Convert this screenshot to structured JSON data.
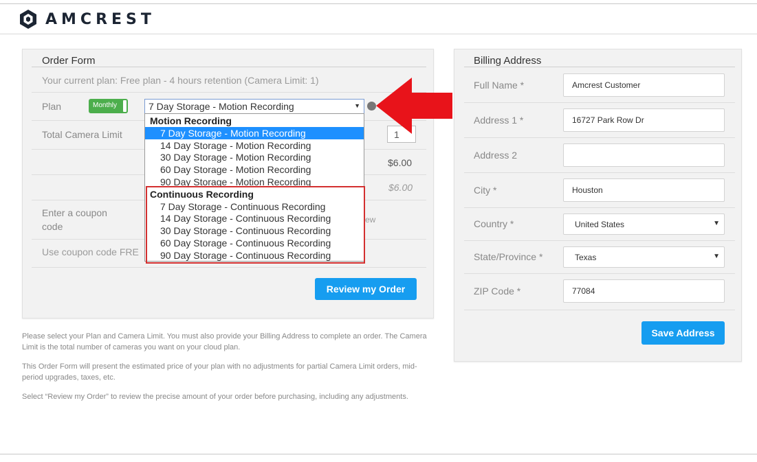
{
  "brand": {
    "name": "AMCREST"
  },
  "order_form": {
    "title": "Order Form",
    "current_plan": "Your current plan: Free plan - 4 hours retention (Camera Limit: 1)",
    "plan_label": "Plan",
    "billing_toggle": "Monthly",
    "plan_selected": "7 Day Storage - Motion Recording",
    "plan_options": {
      "motion_group": "Motion Recording",
      "motion": [
        "7 Day Storage - Motion Recording",
        "14 Day Storage - Motion Recording",
        "30 Day Storage - Motion Recording",
        "60 Day Storage - Motion Recording",
        "90 Day Storage - Motion Recording"
      ],
      "continuous_group": "Continuous Recording",
      "continuous": [
        "7 Day Storage - Continuous Recording",
        "14 Day Storage - Continuous Recording",
        "30 Day Storage - Continuous Recording",
        "60 Day Storage - Continuous Recording",
        "90 Day Storage - Continuous Recording"
      ]
    },
    "camera_limit_label": "Total Camera Limit",
    "camera_limit_value": "1",
    "price": "$6.00",
    "total": "$6.00",
    "coupon_label_1": "Enter a coupon",
    "coupon_label_2": "code",
    "coupon_hint_partial": "ew",
    "coupon_note_partial": "Use coupon code FRE",
    "review_button": "Review my Order"
  },
  "help_text": [
    "Please select your Plan and Camera Limit. You must also provide your Billing Address to complete an order. The Camera Limit is the total number of cameras you want on your cloud plan.",
    "This Order Form will present the estimated price of your plan with no adjustments for partial Camera Limit orders, mid-period upgrades, taxes, etc.",
    "Select “Review my Order” to review the precise amount of your order before purchasing, including any adjustments."
  ],
  "billing": {
    "title": "Billing Address",
    "full_name": {
      "label": "Full Name *",
      "value": "Amcrest Customer"
    },
    "address1": {
      "label": "Address 1 *",
      "value": "16727 Park Row Dr"
    },
    "address2": {
      "label": "Address 2",
      "value": ""
    },
    "city": {
      "label": "City *",
      "value": "Houston"
    },
    "country": {
      "label": "Country *",
      "value": "United States"
    },
    "state": {
      "label": "State/Province *",
      "value": "Texas"
    },
    "zip": {
      "label": "ZIP Code *",
      "value": "77084"
    },
    "save_button": "Save Address"
  },
  "colors": {
    "accent": "#169df0",
    "toggle_green": "#4cae4c",
    "highlight_red": "#d32f2f",
    "arrow_red": "#e8131a",
    "selection_blue": "#1e90ff"
  }
}
